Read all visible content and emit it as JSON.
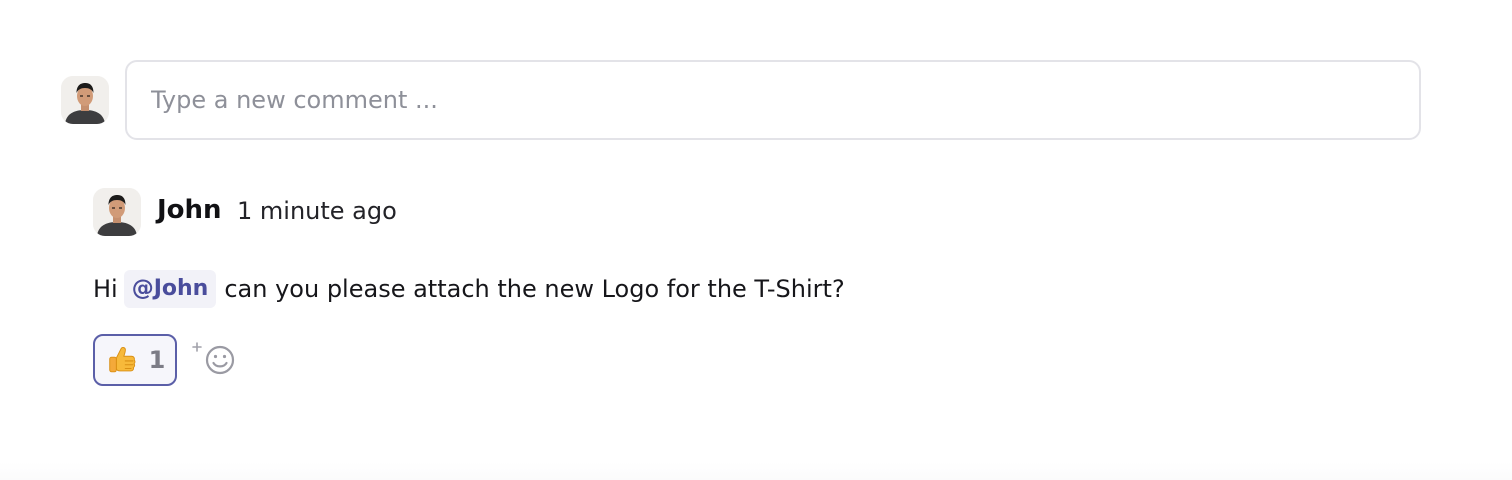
{
  "composer": {
    "placeholder": "Type a new comment ...",
    "avatar_icon": "user-avatar"
  },
  "comment": {
    "author": "John",
    "timestamp": "1 minute ago",
    "text_prefix": "Hi",
    "mention": "@John",
    "text_suffix": "can you please attach the new Logo for the T-Shirt?",
    "avatar_icon": "user-avatar"
  },
  "reactions": [
    {
      "emoji_icon": "thumbs-up-icon",
      "count": "1"
    }
  ],
  "add_reaction": {
    "icon": "add-emoji-icon"
  },
  "colors": {
    "accent": "#5b5fa8",
    "mention_text": "#4a4d9c",
    "input_border": "#e3e3e8",
    "placeholder": "#8e9099"
  }
}
